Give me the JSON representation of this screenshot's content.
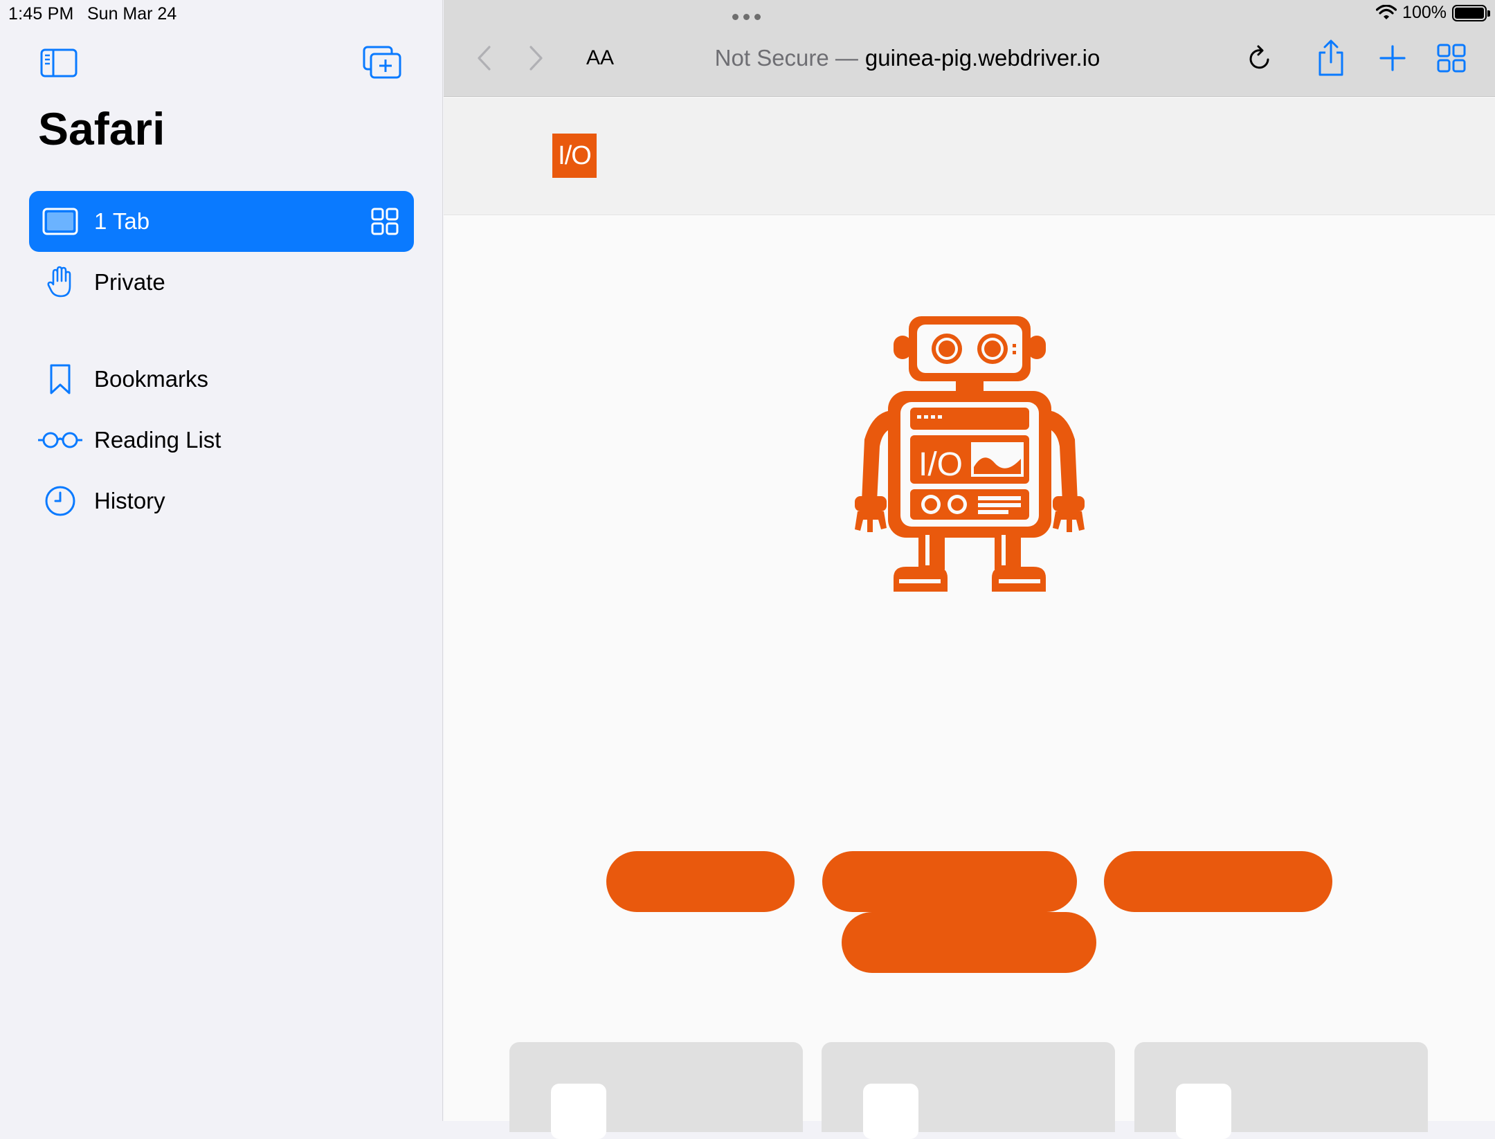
{
  "status_bar": {
    "time": "1:45 PM",
    "date": "Sun Mar 24",
    "battery": "100%"
  },
  "sidebar": {
    "title": "Safari",
    "items": [
      {
        "label": "1 Tab",
        "icon": "ipad-icon",
        "selected": true
      },
      {
        "label": "Private",
        "icon": "hand-icon"
      },
      {
        "label": "Bookmarks",
        "icon": "bookmark-icon"
      },
      {
        "label": "Reading List",
        "icon": "glasses-icon"
      },
      {
        "label": "History",
        "icon": "clock-icon"
      }
    ]
  },
  "toolbar": {
    "text_size_label": "AA",
    "address_security": "Not Secure —",
    "address_host": "guinea-pig.webdriver.io"
  },
  "page": {
    "logo_text": "I/O",
    "robot_screen_text": "I/O",
    "accent_color": "#e9590d"
  },
  "colors": {
    "selection_blue": "#0a7aff",
    "brand_orange": "#e9590d"
  }
}
